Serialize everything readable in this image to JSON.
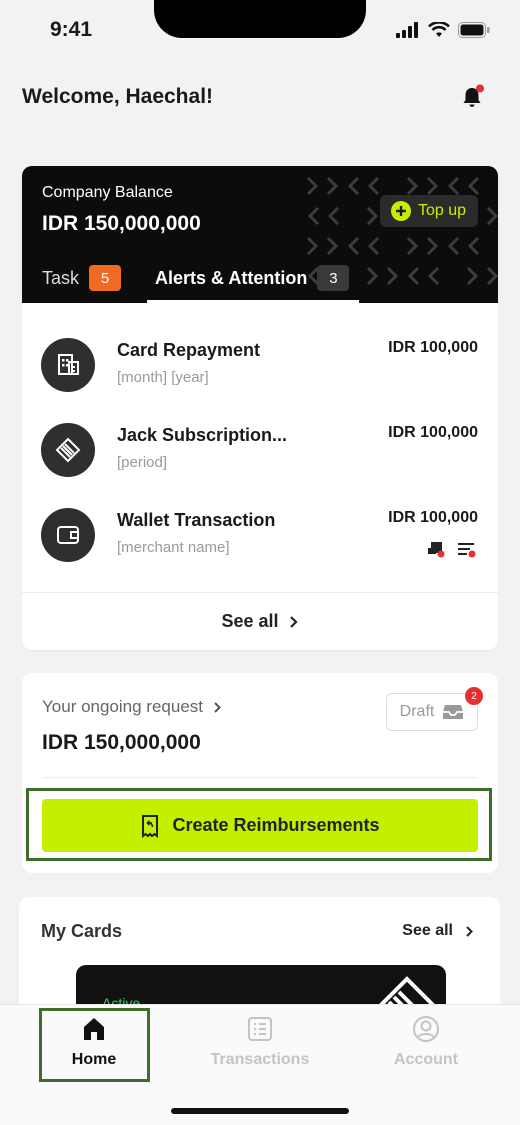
{
  "status_bar": {
    "time": "9:41"
  },
  "header": {
    "welcome": "Welcome, Haechal!"
  },
  "balance": {
    "label": "Company Balance",
    "amount": "IDR 150,000,000",
    "topup_label": "Top up",
    "tabs": [
      {
        "label": "Task",
        "count": "5"
      },
      {
        "label": "Alerts & Attention",
        "count": "3"
      }
    ],
    "alerts": [
      {
        "title": "Card Repayment",
        "subtitle": "[month] [year]",
        "amount": "IDR 100,000",
        "icon": "receipt-building-icon"
      },
      {
        "title": "Jack Subscription...",
        "subtitle": "[period]",
        "amount": "IDR 100,000",
        "icon": "jack-logo-icon"
      },
      {
        "title": "Wallet Transaction",
        "subtitle": "[merchant name]",
        "amount": "IDR 100,000",
        "icon": "wallet-icon"
      }
    ],
    "see_all": "See all"
  },
  "request": {
    "label": "Your ongoing request",
    "amount": "IDR 150,000,000",
    "draft_label": "Draft",
    "draft_count": "2",
    "create_label": "Create Reimbursements"
  },
  "cards": {
    "title": "My Cards",
    "see_all": "See all",
    "card_status": "Active"
  },
  "nav": {
    "items": [
      {
        "label": "Home",
        "icon": "home-icon"
      },
      {
        "label": "Transactions",
        "icon": "list-icon"
      },
      {
        "label": "Account",
        "icon": "user-circle-icon"
      }
    ]
  },
  "colors": {
    "accent": "#c4f000",
    "highlight": "#3e6e2a",
    "badge_orange": "#f06a22"
  }
}
